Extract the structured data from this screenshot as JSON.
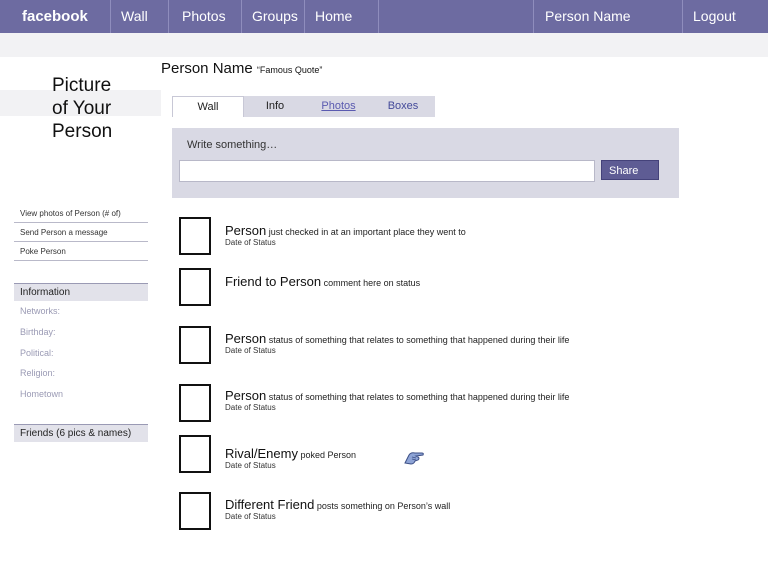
{
  "nav": {
    "brand": "facebook",
    "items": [
      "Wall",
      "Photos",
      "Groups",
      "Home"
    ],
    "user_name": "Person Name",
    "logout": "Logout"
  },
  "sidebar": {
    "picture_placeholder": [
      "Picture",
      "of Your",
      "Person"
    ],
    "links": [
      "View photos of Person (# of)",
      "Send Person a message",
      "Poke Person"
    ],
    "information_heading": "Information",
    "info_items": [
      "Networks:",
      "Birthday:",
      "Political:",
      "Religion:",
      "Hometown"
    ],
    "friends_heading": "Friends (6 pics & names)"
  },
  "profile": {
    "name": "Person Name",
    "quote": "“Famous Quote”"
  },
  "tabs": [
    "Wall",
    "Info",
    "Photos",
    "Boxes"
  ],
  "publisher": {
    "prompt": "Write something…",
    "input_value": "",
    "share_label": "Share"
  },
  "feed": [
    {
      "actor": "Person",
      "text": " just checked in at an important place they went to",
      "date": "Date of Status"
    },
    {
      "actor": "Friend to Person",
      "text": " comment here on status",
      "date": ""
    },
    {
      "actor": "Person",
      "text": " status of something that relates to something that happened during their life",
      "date": "Date of Status"
    },
    {
      "actor": "Person",
      "text": " status of something that relates to something that happened during their life",
      "date": "Date of Status"
    },
    {
      "actor": "Rival/Enemy",
      "text": " poked Person",
      "date": "Date of Status"
    },
    {
      "actor": "Different Friend",
      "text": " posts something on Person’s wall",
      "date": "Date of Status"
    }
  ],
  "colors": {
    "topbar": "#6d6ba1",
    "panel": "#d9d9e4",
    "button": "#5e5c94"
  },
  "icons": {
    "poke": "poke-hand-icon"
  }
}
